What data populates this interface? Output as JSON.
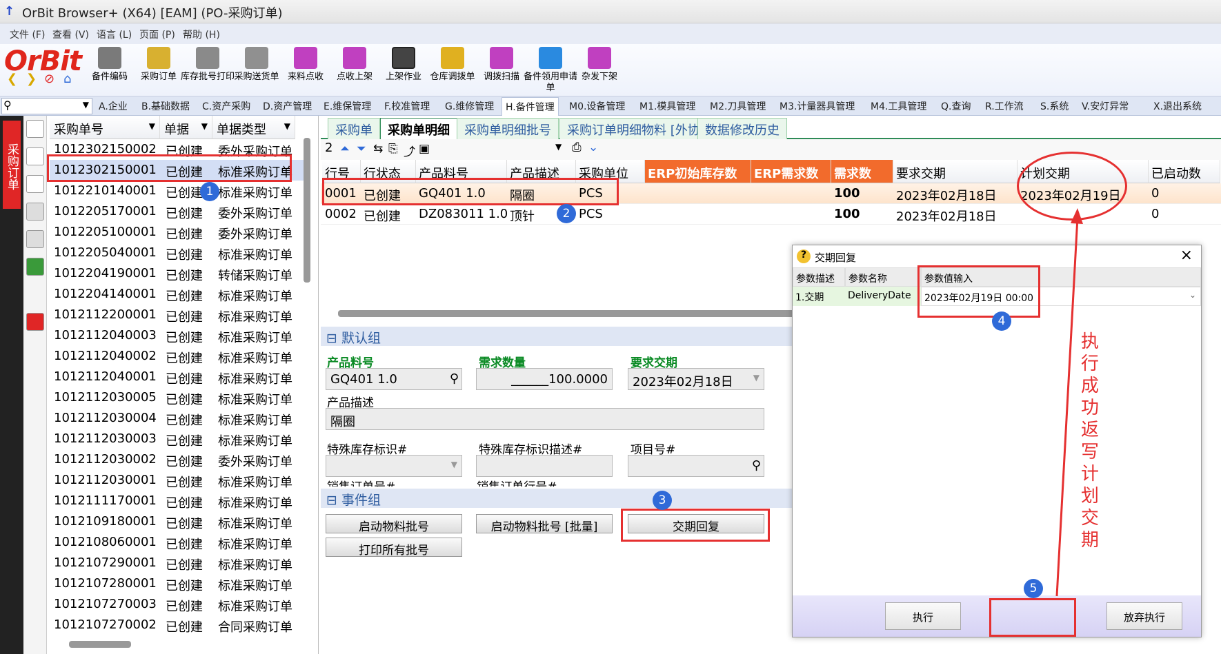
{
  "window": {
    "title": "OrBit Browser+ (X64) [EAM] (PO-采购订单)",
    "icon": "orbit-app-icon"
  },
  "menu": [
    "文件 (F)",
    "查看 (V)",
    "语言 (L)",
    "页面 (P)",
    "帮助 (H)"
  ],
  "logo": "OrBit",
  "toolbar": [
    "备件编码",
    "采购订单",
    "库存批号打印",
    "采购送货单",
    "来料点收",
    "点收上架",
    "上架作业",
    "仓库调拨单",
    "调拨扫描",
    "备件领用申请单",
    "杂发下架"
  ],
  "modules": [
    "A.企业",
    "B.基础数据",
    "C.资产采购",
    "D.资产管理",
    "E.维保管理",
    "F.校准管理",
    "G.维修管理",
    "H.备件管理",
    "M0.设备管理",
    "M1.模具管理",
    "M2.刀具管理",
    "M3.计量器具管理",
    "M4.工具管理",
    "Q.查询",
    "R.工作流",
    "S.系统",
    "V.安灯异常",
    "X.退出系统"
  ],
  "vtab": "采购订单",
  "left": {
    "headers": [
      "采购单号",
      "单据",
      "单据类型"
    ],
    "rows": [
      [
        "1012302150002",
        "已创建",
        "委外采购订单"
      ],
      [
        "1012302150001",
        "已创建",
        "标准采购订单"
      ],
      [
        "1012210140001",
        "已创建",
        "标准采购订单"
      ],
      [
        "1012205170001",
        "已创建",
        "委外采购订单"
      ],
      [
        "1012205100001",
        "已创建",
        "委外采购订单"
      ],
      [
        "1012205040001",
        "已创建",
        "标准采购订单"
      ],
      [
        "1012204190001",
        "已创建",
        "转储采购订单"
      ],
      [
        "1012204140001",
        "已创建",
        "标准采购订单"
      ],
      [
        "1012112200001",
        "已创建",
        "标准采购订单"
      ],
      [
        "1012112040003",
        "已创建",
        "标准采购订单"
      ],
      [
        "1012112040002",
        "已创建",
        "标准采购订单"
      ],
      [
        "1012112040001",
        "已创建",
        "标准采购订单"
      ],
      [
        "1012112030005",
        "已创建",
        "标准采购订单"
      ],
      [
        "1012112030004",
        "已创建",
        "标准采购订单"
      ],
      [
        "1012112030003",
        "已创建",
        "标准采购订单"
      ],
      [
        "1012112030002",
        "已创建",
        "委外采购订单"
      ],
      [
        "1012112030001",
        "已创建",
        "标准采购订单"
      ],
      [
        "1012111170001",
        "已创建",
        "标准采购订单"
      ],
      [
        "1012109180001",
        "已创建",
        "标准采购订单"
      ],
      [
        "1012108060001",
        "已创建",
        "标准采购订单"
      ],
      [
        "1012107290001",
        "已创建",
        "标准采购订单"
      ],
      [
        "1012107280001",
        "已创建",
        "标准采购订单"
      ],
      [
        "1012107270003",
        "已创建",
        "标准采购订单"
      ],
      [
        "1012107270002",
        "已创建",
        "合同采购订单"
      ]
    ]
  },
  "tabs": [
    "采购单",
    "采购单明细",
    "采购单明细批号",
    "采购订单明细物料 [外协]",
    "数据修改历史"
  ],
  "rtool_count": "2",
  "grid": {
    "headers": [
      "行号",
      "行状态",
      "产品料号",
      "产品描述",
      "采购单位",
      "ERP初始库存数",
      "ERP需求数",
      "需求数",
      "要求交期",
      "计划交期",
      "已启动数"
    ],
    "rows": [
      [
        "0001",
        "已创建",
        "GQ401 1.0",
        "隔圈",
        "PCS",
        "",
        "",
        "100",
        "2023年02月18日",
        "2023年02月19日",
        "0"
      ],
      [
        "0002",
        "已创建",
        "DZ083011 1.0",
        "顶针",
        "PCS",
        "",
        "",
        "100",
        "2023年02月18日",
        "",
        "0"
      ]
    ]
  },
  "default_group": {
    "title": "默认组",
    "product_label": "产品料号",
    "product": "GQ401 1.0",
    "qty_label": "需求数量",
    "qty": "______100.0000",
    "date_label": "要求交期",
    "date": "2023年02月18日",
    "desc_label": "产品描述",
    "desc": "隔圈",
    "stock_label": "特殊库存标识#",
    "stock_desc_label": "特殊库存标识描述#",
    "project_label": "项目号#",
    "sales_label": "销售订单号#",
    "sales_line_label": "销售订单行号#"
  },
  "event_group": {
    "title": "事件组",
    "btn1": "启动物料批号",
    "btn2": "启动物料批号 [批量]",
    "btn3": "交期回复",
    "btn4": "打印所有批号"
  },
  "dialog": {
    "title": "交期回复",
    "headers": [
      "参数描述",
      "参数名称",
      "参数值输入"
    ],
    "row": [
      "1.交期",
      "DeliveryDate",
      "2023年02月19日 00:00"
    ],
    "execute": "执行",
    "cancel": "放弃执行"
  },
  "annotation": "执行成功返写计划交期",
  "markers": [
    "1",
    "2",
    "3",
    "4",
    "5"
  ]
}
